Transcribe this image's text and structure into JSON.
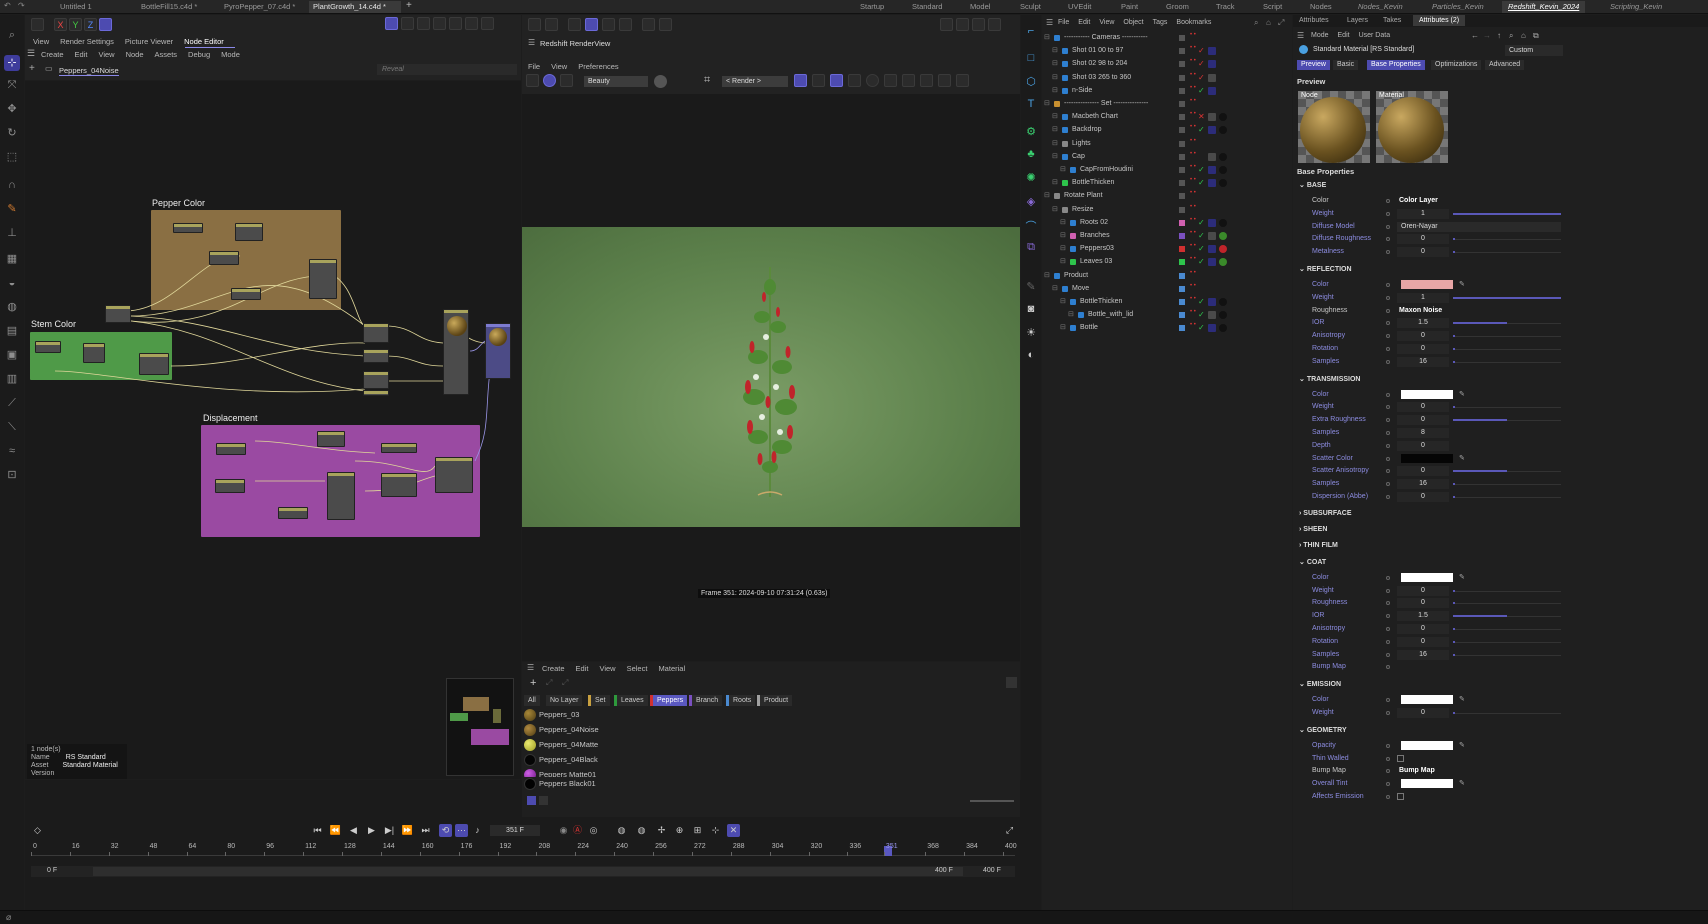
{
  "titlebar": {
    "doc_tabs": [
      "Untitled 1",
      "BottleFill15.c4d *",
      "PyroPepper_07.c4d *",
      "PlantGrowth_14.c4d *"
    ],
    "layout_tabs": [
      "Startup",
      "Standard",
      "Model",
      "Sculpt",
      "UVEdit",
      "Paint",
      "Groom",
      "Track",
      "Script",
      "Nodes",
      "Nodes_Kevin",
      "Particles_Kevin",
      "Redshift_Kevin_2024",
      "Scripting_Kevin"
    ],
    "active_layout": "Redshift_Kevin_2024",
    "add": "+"
  },
  "node_editor": {
    "tabs": [
      "View",
      "Render Settings",
      "Picture Viewer",
      "Node Editor"
    ],
    "menu": [
      "Create",
      "Edit",
      "View",
      "Node",
      "Assets",
      "Debug",
      "Mode"
    ],
    "breadcrumb": "Peppers_04Noise",
    "reveal": "Reveal",
    "groups": {
      "pepper": "Pepper Color",
      "stem": "Stem Color",
      "disp": "Displacement"
    },
    "info": {
      "count": "1 node(s)",
      "name_label": "Name",
      "name_value": "RS Standard",
      "asset_label": "Asset",
      "asset_value": "Standard Material",
      "version_label": "Version"
    }
  },
  "renderview": {
    "title": "Redshift RenderView",
    "menu": [
      "File",
      "View",
      "Preferences"
    ],
    "aov": "Beauty",
    "render_sel": "< Render >",
    "frame_info": "Frame  351:  2024-09-10  07:31:24  (0.63s)"
  },
  "material_manager": {
    "menu": [
      "Create",
      "Edit",
      "View",
      "Select",
      "Material"
    ],
    "filters": [
      "All",
      "No Layer",
      "Set",
      "Leaves",
      "Peppers",
      "Branch",
      "Roots",
      "Product"
    ],
    "active_filter": "Peppers",
    "materials": [
      {
        "name": "Peppers_03",
        "color": "#6b5320"
      },
      {
        "name": "Peppers_04Noise",
        "color": "#6e5522"
      },
      {
        "name": "Peppers_04Matte",
        "color": "#c6c53a"
      },
      {
        "name": "Peppers_04Black",
        "color": "#0a0a0a"
      },
      {
        "name": "Peppers Matte01",
        "color": "#a12ec0"
      },
      {
        "name": "Peppers Black01",
        "color": "#050505"
      }
    ]
  },
  "timeline": {
    "frame_field": "351 F",
    "ticks": [
      "0",
      "16",
      "32",
      "48",
      "64",
      "80",
      "96",
      "112",
      "128",
      "144",
      "160",
      "176",
      "192",
      "208",
      "224",
      "240",
      "256",
      "272",
      "288",
      "304",
      "320",
      "336",
      "351",
      "368",
      "384",
      "400"
    ],
    "current": "351",
    "start_a": "0 F",
    "start_b": "0 F",
    "end_a": "400 F",
    "end_b": "400 F"
  },
  "object_manager": {
    "menu": [
      "File",
      "Edit",
      "View",
      "Object",
      "Tags",
      "Bookmarks"
    ],
    "rows": [
      {
        "name": "----------- Cameras -----------",
        "indent": 0
      },
      {
        "name": "Shot 01 00 to 97",
        "indent": 1
      },
      {
        "name": "Shot 02 98 to 204",
        "indent": 1
      },
      {
        "name": "Shot 03 265 to 360",
        "indent": 1
      },
      {
        "name": "n-Side",
        "indent": 1
      },
      {
        "name": "--------------- Set ---------------",
        "indent": 0
      },
      {
        "name": "Macbeth Chart",
        "indent": 1
      },
      {
        "name": "Backdrop",
        "indent": 1
      },
      {
        "name": "Lights",
        "indent": 1
      },
      {
        "name": "Cap",
        "indent": 1
      },
      {
        "name": "CapFromHoudini",
        "indent": 2
      },
      {
        "name": "BottleThicken",
        "indent": 1
      },
      {
        "name": "Rotate Plant",
        "indent": 0
      },
      {
        "name": "Resize",
        "indent": 1
      },
      {
        "name": "Roots 02",
        "indent": 2
      },
      {
        "name": "Branches",
        "indent": 2
      },
      {
        "name": "Peppers03",
        "indent": 2
      },
      {
        "name": "Leaves 03",
        "indent": 2
      },
      {
        "name": "Product",
        "indent": 0
      },
      {
        "name": "Move",
        "indent": 1
      },
      {
        "name": "BottleThicken",
        "indent": 2
      },
      {
        "name": "Bottle_with_lid",
        "indent": 3
      },
      {
        "name": "Bottle",
        "indent": 2
      }
    ]
  },
  "attributes": {
    "tabs": [
      "Attributes",
      "Layers",
      "Takes",
      "Attributes (2)"
    ],
    "menu": [
      "Mode",
      "Edit",
      "User Data"
    ],
    "material": "Standard Material [RS Standard]",
    "custom": "Custom",
    "subtabs": [
      "Preview",
      "Basic",
      "Base Properties",
      "Optimizations",
      "Advanced"
    ],
    "preview_label": "Preview",
    "node_label": "Node",
    "material_label": "Material",
    "base_props": "Base Properties",
    "sections": {
      "base": "BASE",
      "reflection": "REFLECTION",
      "transmission": "TRANSMISSION",
      "subsurface": "SUBSURFACE",
      "sheen": "SHEEN",
      "thinfilm": "THIN FILM",
      "coat": "COAT",
      "emission": "EMISSION",
      "geometry": "GEOMETRY"
    },
    "base": [
      {
        "label": "Color",
        "value": "Color Layer"
      },
      {
        "label": "Weight",
        "value": "1"
      },
      {
        "label": "Diffuse Model",
        "value": "Oren-Nayar"
      },
      {
        "label": "Diffuse Roughness",
        "value": "0"
      },
      {
        "label": "Metalness",
        "value": "0"
      }
    ],
    "reflection": [
      {
        "label": "Color",
        "value": ""
      },
      {
        "label": "Weight",
        "value": "1"
      },
      {
        "label": "Roughness",
        "value": "Maxon Noise"
      },
      {
        "label": "IOR",
        "value": "1.5"
      },
      {
        "label": "Anisotropy",
        "value": "0"
      },
      {
        "label": "Rotation",
        "value": "0"
      },
      {
        "label": "Samples",
        "value": "16"
      }
    ],
    "transmission": [
      {
        "label": "Color",
        "value": ""
      },
      {
        "label": "Weight",
        "value": "0"
      },
      {
        "label": "Extra Roughness",
        "value": "0"
      },
      {
        "label": "Samples",
        "value": "8"
      },
      {
        "label": "Depth",
        "value": "0"
      },
      {
        "label": "Scatter Color",
        "value": ""
      },
      {
        "label": "Scatter Anisotropy",
        "value": "0"
      },
      {
        "label": "Samples",
        "value": "16"
      },
      {
        "label": "Dispersion (Abbe)",
        "value": "0"
      }
    ],
    "coat": [
      {
        "label": "Color",
        "value": ""
      },
      {
        "label": "Weight",
        "value": "0"
      },
      {
        "label": "Roughness",
        "value": "0"
      },
      {
        "label": "IOR",
        "value": "1.5"
      },
      {
        "label": "Anisotropy",
        "value": "0"
      },
      {
        "label": "Rotation",
        "value": "0"
      },
      {
        "label": "Samples",
        "value": "16"
      },
      {
        "label": "Bump Map",
        "value": ""
      }
    ],
    "emission": [
      {
        "label": "Color",
        "value": ""
      },
      {
        "label": "Weight",
        "value": "0"
      }
    ],
    "geometry": [
      {
        "label": "Opacity",
        "value": ""
      },
      {
        "label": "Thin Walled",
        "value": ""
      },
      {
        "label": "Bump Map",
        "value": "Bump Map"
      },
      {
        "label": "Overall Tint",
        "value": ""
      },
      {
        "label": "Affects Emission",
        "value": ""
      }
    ]
  },
  "colors": {
    "accent": "#4d4bb0",
    "pepper_group": "#8a6f43",
    "stem_group": "#4f9a48",
    "disp_group": "#9a4aa2",
    "refl_color": "#e8a6a6"
  }
}
